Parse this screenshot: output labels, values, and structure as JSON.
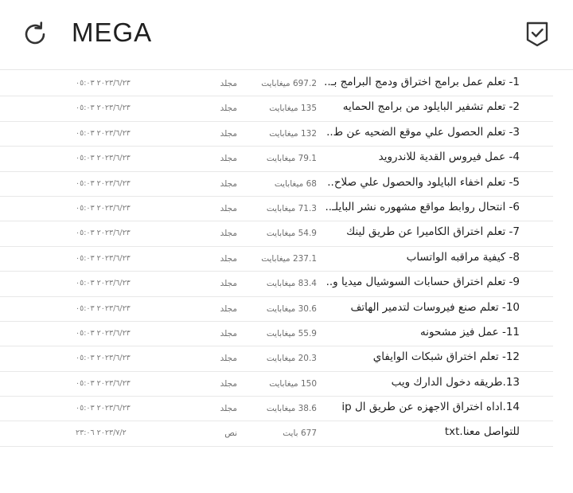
{
  "app": {
    "title": "MEGA"
  },
  "icons": {
    "refresh": "refresh-icon",
    "select": "check-shield-icon"
  },
  "colors": {
    "divider": "#e8e8e8",
    "text": "#1d1d1d",
    "meta": "#6e6e6e"
  },
  "files": [
    {
      "name": "1- تعلم عمل برامج اختراق ودمج البرامج بـ..",
      "size": "697.2 ميغابايت",
      "type": "مجلد",
      "date": "٢٠٢٣/٦/٢٣ ٠٥:٠٣"
    },
    {
      "name": "2- تعلم تشفير البايلود من برامج الحمايه",
      "size": "135 ميغابايت",
      "type": "مجلد",
      "date": "٢٠٢٣/٦/٢٣ ٠٥:٠٣"
    },
    {
      "name": "3- تعلم الحصول علي موقع الضحيه عن ط..",
      "size": "132 ميغابايت",
      "type": "مجلد",
      "date": "٢٠٢٣/٦/٢٣ ٠٥:٠٣"
    },
    {
      "name": "4- عمل فيروس القدية للاندرويد",
      "size": "79.1 ميغابايت",
      "type": "مجلد",
      "date": "٢٠٢٣/٦/٢٣ ٠٥:٠٣"
    },
    {
      "name": "5- تعلم اخفاء البايلود والحصول علي صلاح..",
      "size": "68 ميغابايت",
      "type": "مجلد",
      "date": "٢٠٢٣/٦/٢٣ ٠٥:٠٣"
    },
    {
      "name": "6- انتحال روابط مواقع مشهوره نشر البايلـ..",
      "size": "71.3 ميغابايت",
      "type": "مجلد",
      "date": "٢٠٢٣/٦/٢٣ ٠٥:٠٣"
    },
    {
      "name": "7- تعلم اختراق الكاميرا عن طريق لينك",
      "size": "54.9 ميغابايت",
      "type": "مجلد",
      "date": "٢٠٢٣/٦/٢٣ ٠٥:٠٣"
    },
    {
      "name": "8- كيفية مراقبه الواتساب",
      "size": "237.1 ميغابايت",
      "type": "مجلد",
      "date": "٢٠٢٣/٦/٢٣ ٠٥:٠٣"
    },
    {
      "name": "9- تعلم اختراق حسابات السوشيال ميديا و..",
      "size": "83.4 ميغابايت",
      "type": "مجلد",
      "date": "٢٠٢٣/٦/٢٣ ٠٥:٠٣"
    },
    {
      "name": "10- تعلم صنع فيروسات لتدمير الهاتف",
      "size": "30.6 ميغابايت",
      "type": "مجلد",
      "date": "٢٠٢٣/٦/٢٣ ٠٥:٠٣"
    },
    {
      "name": "11- عمل فيز مشحونه",
      "size": "55.9 ميغابايت",
      "type": "مجلد",
      "date": "٢٠٢٣/٦/٢٣ ٠٥:٠٣"
    },
    {
      "name": "12- تعلم اختراق شبكات الوايفاي",
      "size": "20.3 ميغابايت",
      "type": "مجلد",
      "date": "٢٠٢٣/٦/٢٣ ٠٥:٠٣"
    },
    {
      "name": "13.طريقه دخول الدارك ويب",
      "size": "150 ميغابايت",
      "type": "مجلد",
      "date": "٢٠٢٣/٦/٢٣ ٠٥:٠٣"
    },
    {
      "name": "14.اداه اختراق الاجهزه عن طريق ال ip",
      "size": "38.6 ميغابايت",
      "type": "مجلد",
      "date": "٢٠٢٣/٦/٢٣ ٠٥:٠٣"
    },
    {
      "name": "للتواصل معنا.txt",
      "size": "677 بايت",
      "type": "نص",
      "date": "٢٠٢٣/٧/٢ ٢٣:٠٦"
    }
  ]
}
